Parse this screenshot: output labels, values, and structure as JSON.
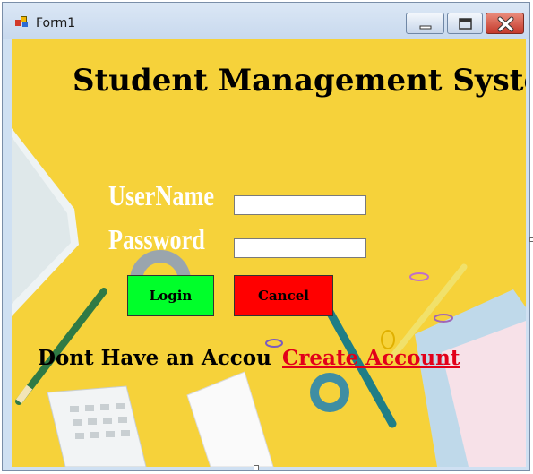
{
  "window": {
    "title": "Form1",
    "icons": {
      "app": "form-app-icon",
      "minimize": "minimize-icon",
      "maximize": "maximize-icon",
      "close": "close-icon"
    }
  },
  "form": {
    "heading": "Student Management Syster",
    "username_label": "UserName",
    "password_label": "Password",
    "username_value": "",
    "password_value": "",
    "login_label": "Login",
    "cancel_label": "Cancel",
    "no_account_text": "Dont Have an Accou",
    "create_account_link": "Create Account"
  },
  "colors": {
    "background": "#f6d23a",
    "login_button": "#00ff2a",
    "cancel_button": "#ff0000",
    "link": "#e2001a"
  }
}
